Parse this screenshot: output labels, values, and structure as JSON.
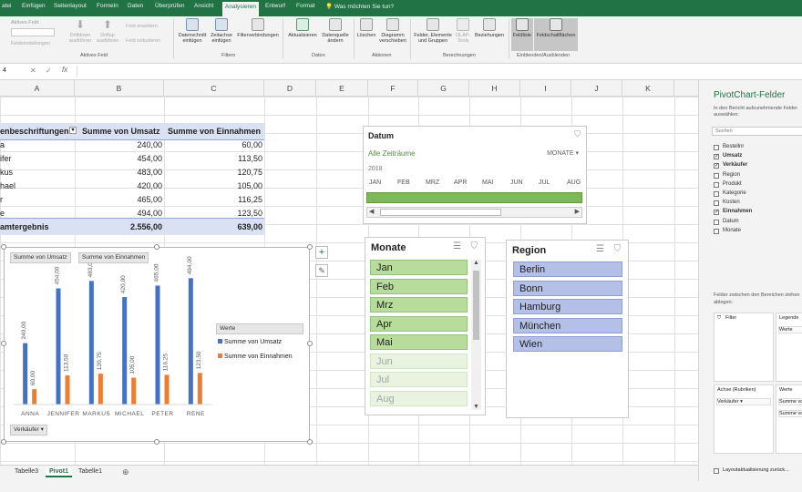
{
  "ribbon_tabs": [
    "atei",
    "Einfügen",
    "Seitenlayout",
    "Formeln",
    "Daten",
    "Überprüfen",
    "Ansicht",
    "Analysieren",
    "Entwurf",
    "Format"
  ],
  "active_tab": "Analysieren",
  "tell_me": "Was möchten Sie tun?",
  "ribbon": {
    "active_field_label": "Aktives Feld:",
    "field_settings": "Feldeinstellungen",
    "drilldown": "Drilldown ausführen",
    "drillup": "Drillup ausführen",
    "expand": "Feld erweitern",
    "collapse": "Feld reduzieren",
    "btn_slicer": "Datenschnitt einfügen",
    "btn_timeline": "Zeitachse einfügen",
    "btn_filterconn": "Filterverbindungen",
    "btn_refresh": "Aktualisieren",
    "btn_datasource": "Datenquelle ändern",
    "btn_delete": "Löschen",
    "btn_move": "Diagramm verschieben",
    "btn_fields": "Felder, Elemente und Gruppen",
    "btn_olap": "OLAP-Tools",
    "btn_relations": "Beziehungen",
    "btn_fieldlist": "Feldliste",
    "btn_fieldbuttons": "Feldschaltflächen",
    "grp_active": "Aktives Feld",
    "grp_filter": "Filtern",
    "grp_data": "Daten",
    "grp_actions": "Aktionen",
    "grp_calc": "Berechnungen",
    "grp_show": "Einblenden/Ausblenden"
  },
  "namebox": "4",
  "columns": [
    "A",
    "B",
    "C",
    "D",
    "E",
    "F",
    "G",
    "H",
    "I",
    "J",
    "K"
  ],
  "pivot": {
    "header": [
      "enbeschriftungen",
      "Summe von Umsatz",
      "Summe von Einnahmen"
    ],
    "rows": [
      [
        "a",
        "240,00",
        "60,00"
      ],
      [
        "ifer",
        "454,00",
        "113,50"
      ],
      [
        "kus",
        "483,00",
        "120,75"
      ],
      [
        "hael",
        "420,00",
        "105,00"
      ],
      [
        "r",
        "465,00",
        "116,25"
      ],
      [
        "e",
        "494,00",
        "123,50"
      ]
    ],
    "total": [
      "amtergebnis",
      "2.556,00",
      "639,00"
    ]
  },
  "chart_data": {
    "type": "bar",
    "categories": [
      "ANNA",
      "JENNIFER",
      "MARKUS",
      "MICHAEL",
      "PETER",
      "RENE"
    ],
    "series": [
      {
        "name": "Summe von Umsatz",
        "values": [
          240,
          454,
          483,
          420,
          465,
          494
        ],
        "color": "#4472c4"
      },
      {
        "name": "Summe von Einnahmen",
        "values": [
          60,
          113.5,
          120.75,
          105,
          116.25,
          123.5
        ],
        "color": "#ed7d31"
      }
    ],
    "data_labels_umsatz": [
      "240,00",
      "454,00",
      "483,00",
      "420,00",
      "465,00",
      "494,00"
    ],
    "data_labels_einnahmen": [
      "60,00",
      "113,50",
      "120,75",
      "105,00",
      "116,25",
      "123,50"
    ],
    "legend_title": "Werte",
    "value_field_button": "Summe von Umsatz",
    "value_field_button2": "Summe von Einnahmen",
    "axis_field_button": "Verkäufer",
    "ylim": [
      0,
      520
    ]
  },
  "timeline": {
    "title": "Datum",
    "all_periods": "Alle Zeiträume",
    "level": "MONATE",
    "year": "2018",
    "months": [
      "JAN",
      "FEB",
      "MRZ",
      "APR",
      "MAI",
      "JUN",
      "JUL",
      "AUG"
    ]
  },
  "slicer_monate": {
    "title": "Monate",
    "items": [
      "Jan",
      "Feb",
      "Mrz",
      "Apr",
      "Mai",
      "Jun",
      "Jul",
      "Aug"
    ],
    "active_count": 5
  },
  "slicer_region": {
    "title": "Region",
    "items": [
      "Berlin",
      "Bonn",
      "Hamburg",
      "München",
      "Wien"
    ]
  },
  "field_pane": {
    "title": "PivotChart-Felder",
    "subtitle1": "In den Bericht aufzunehmende Felder",
    "subtitle2": "auswählen:",
    "search": "Suchen",
    "fields": [
      {
        "name": "Bestellnr",
        "checked": false
      },
      {
        "name": "Umsatz",
        "checked": true
      },
      {
        "name": "Verkäufer",
        "checked": true
      },
      {
        "name": "Region",
        "checked": false
      },
      {
        "name": "Produkt",
        "checked": false
      },
      {
        "name": "Kategorie",
        "checked": false
      },
      {
        "name": "Kosten",
        "checked": false
      },
      {
        "name": "Einnahmen",
        "checked": true
      },
      {
        "name": "Datum",
        "checked": false
      },
      {
        "name": "Monate",
        "checked": false
      }
    ],
    "drag_hint1": "Felder zwischen den Bereichen ziehen",
    "drag_hint2": "ablegen:",
    "area_filter": "Filter",
    "area_legend": "Legende",
    "area_axis": "Achse (Rubriken)",
    "area_values": "Werte",
    "legend_item": "Werte",
    "axis_item": "Verkäufer",
    "value_item1": "Summe vo",
    "value_item2": "Summe vo",
    "defer": "Layoutaktualisierung zurück..."
  },
  "sheet_tabs": [
    "Tabelle3",
    "Pivot1",
    "Tabelle1"
  ],
  "active_sheet": "Pivot1"
}
